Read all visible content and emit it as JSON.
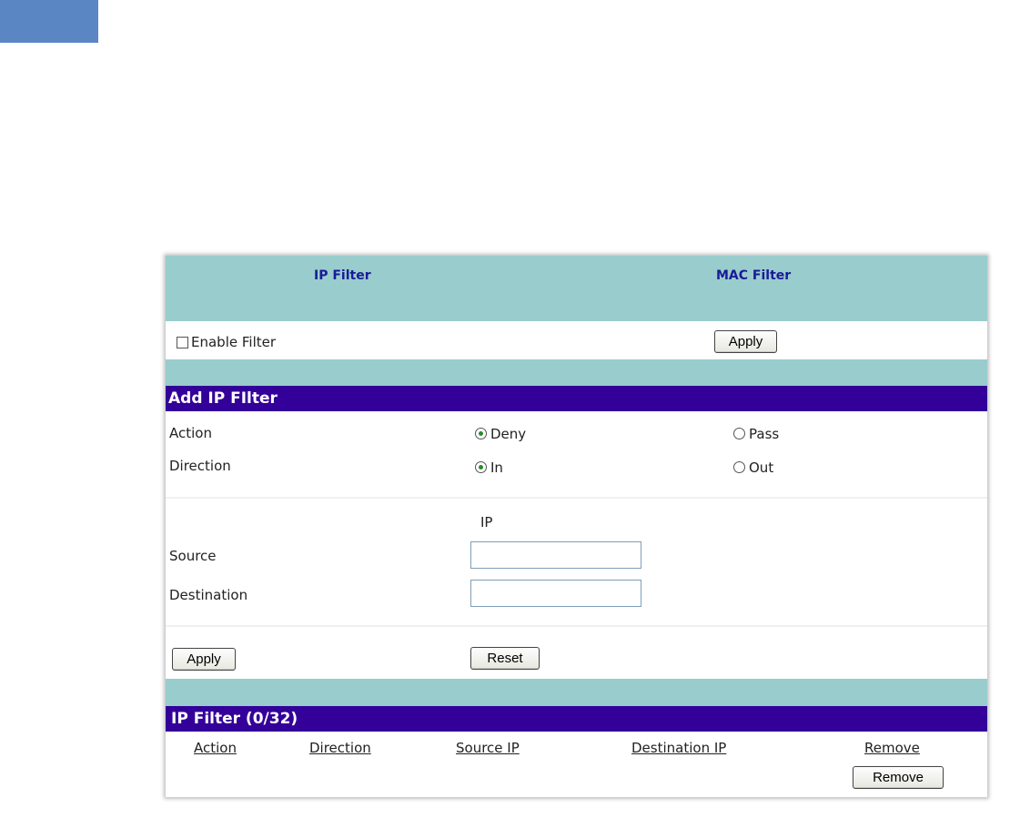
{
  "tabs": {
    "ip_filter": "IP Filter",
    "mac_filter": "MAC Filter"
  },
  "enable": {
    "label": "Enable Filter",
    "checked": false,
    "apply_label": "Apply"
  },
  "add_section": {
    "title": "Add IP FIlter",
    "action_label": "Action",
    "action_deny": "Deny",
    "action_pass": "Pass",
    "action_selected": "Deny",
    "direction_label": "Direction",
    "direction_in": "In",
    "direction_out": "Out",
    "direction_selected": "In",
    "ip_header": "IP",
    "source_label": "Source",
    "source_value": "",
    "destination_label": "Destination",
    "destination_value": "",
    "apply_label": "Apply",
    "reset_label": "Reset"
  },
  "list_section": {
    "title": "IP Filter (0/32)",
    "columns": [
      "Action",
      "Direction",
      "Source IP",
      "Destination IP",
      "Remove"
    ],
    "remove_button": "Remove"
  },
  "colors": {
    "teal": "#99cccc",
    "purple": "#330099",
    "tab_text": "#1a1a9a",
    "corner": "#5b86c4"
  }
}
